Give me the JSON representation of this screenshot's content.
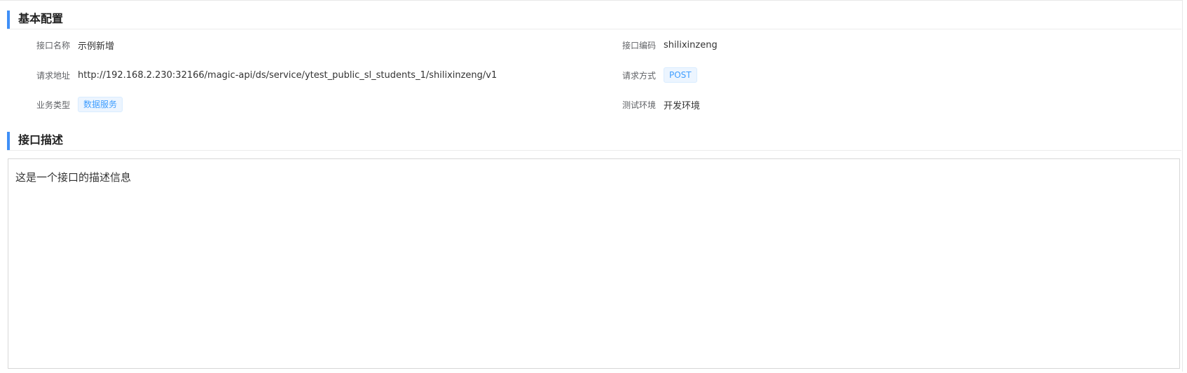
{
  "basic": {
    "title": "基本配置",
    "fields": {
      "name": {
        "label": "接口名称",
        "value": "示例新增"
      },
      "code": {
        "label": "接口编码",
        "value": "shilixinzeng"
      },
      "url": {
        "label": "请求地址",
        "value": "http://192.168.2.230:32166/magic-api/ds/service/ytest_public_sl_students_1/shilixinzeng/v1"
      },
      "method": {
        "label": "请求方式",
        "value": "POST"
      },
      "biz_type": {
        "label": "业务类型",
        "value": "数据服务"
      },
      "env": {
        "label": "测试环境",
        "value": "开发环境"
      }
    }
  },
  "description": {
    "title": "接口描述",
    "text": "这是一个接口的描述信息"
  },
  "colors": {
    "accent": "#3f8ff7",
    "tag_text": "#409eff",
    "tag_bg": "#ecf5ff"
  }
}
